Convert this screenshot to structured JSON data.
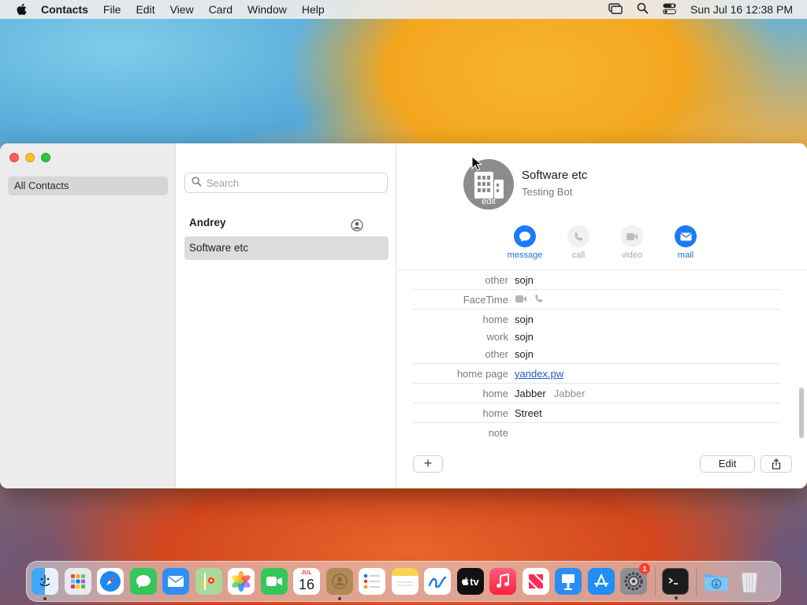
{
  "menubar": {
    "app": "Contacts",
    "items": [
      "File",
      "Edit",
      "View",
      "Card",
      "Window",
      "Help"
    ],
    "clock": "Sun Jul 16  12:38 PM"
  },
  "sidebar": {
    "group": "All Contacts"
  },
  "list": {
    "search_placeholder": "Search",
    "contacts": [
      "Andrey",
      "Software etc"
    ]
  },
  "detail": {
    "avatar_edit": "edit",
    "name": "Software etc",
    "company": "Testing Bot",
    "actions": [
      {
        "label": "message",
        "enabled": true
      },
      {
        "label": "call",
        "enabled": false
      },
      {
        "label": "video",
        "enabled": false
      },
      {
        "label": "mail",
        "enabled": true
      }
    ],
    "fields": {
      "other_phone": {
        "label": "other",
        "value": "sojn"
      },
      "facetime": {
        "label": "FaceTime"
      },
      "home_email": {
        "label": "home",
        "value": "sojn"
      },
      "work_email": {
        "label": "work",
        "value": "sojn"
      },
      "other_email": {
        "label": "other",
        "value": "sojn"
      },
      "homepage": {
        "label": "home page",
        "value": "yandex.pw"
      },
      "im": {
        "label": "home",
        "value": "Jabber",
        "service": "Jabber"
      },
      "address": {
        "label": "home",
        "value": "Street"
      },
      "note": {
        "label": "note",
        "value": ""
      }
    },
    "edit_label": "Edit",
    "add_label": "+"
  },
  "dock": {
    "calendar_month": "JUL",
    "calendar_day": "16",
    "tv_label": "tv",
    "settings_badge": "1"
  },
  "colors": {
    "accent": "#1c7bf2",
    "selection": "#dcdcdc"
  }
}
